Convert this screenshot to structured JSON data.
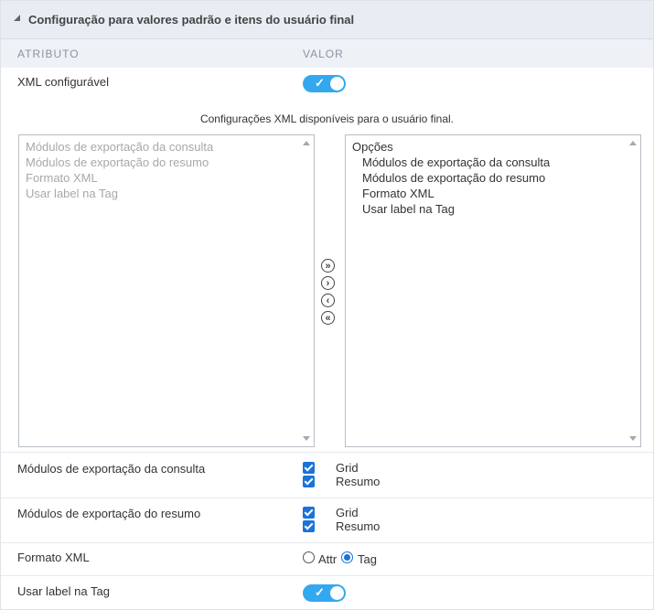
{
  "header": {
    "title": "Configuração para valores padrão e itens do usuário final"
  },
  "columns": {
    "attribute": "ATRIBUTO",
    "value": "VALOR"
  },
  "xml_configurable": {
    "label": "XML configurável",
    "toggle_on": true
  },
  "xml_caption": "Configurações XML disponíveis para o usuário final.",
  "available_list": [
    "Módulos de exportação da consulta",
    "Módulos de exportação do resumo",
    "Formato XML",
    "Usar label na Tag"
  ],
  "selected_list": {
    "group": "Opções",
    "items": [
      "Módulos de exportação da consulta",
      "Módulos de exportação do resumo",
      "Formato XML",
      "Usar label na Tag"
    ]
  },
  "transfer_buttons": {
    "move_all_right": "»",
    "move_right": "›",
    "move_left": "‹",
    "move_all_left": "«"
  },
  "export_consulta": {
    "label": "Módulos de exportação da consulta",
    "opt1": "Grid",
    "opt2": "Resumo"
  },
  "export_resumo": {
    "label": "Módulos de exportação do resumo",
    "opt1": "Grid",
    "opt2": "Resumo"
  },
  "xml_format": {
    "label": "Formato XML",
    "opt_attr": "Attr",
    "opt_tag": "Tag",
    "selected": "Tag"
  },
  "use_label_tag": {
    "label": "Usar label na Tag",
    "toggle_on": true
  },
  "colors": {
    "accent": "#33a8ef",
    "checkbox": "#1a73d8",
    "header_bg": "#e8edf3"
  }
}
